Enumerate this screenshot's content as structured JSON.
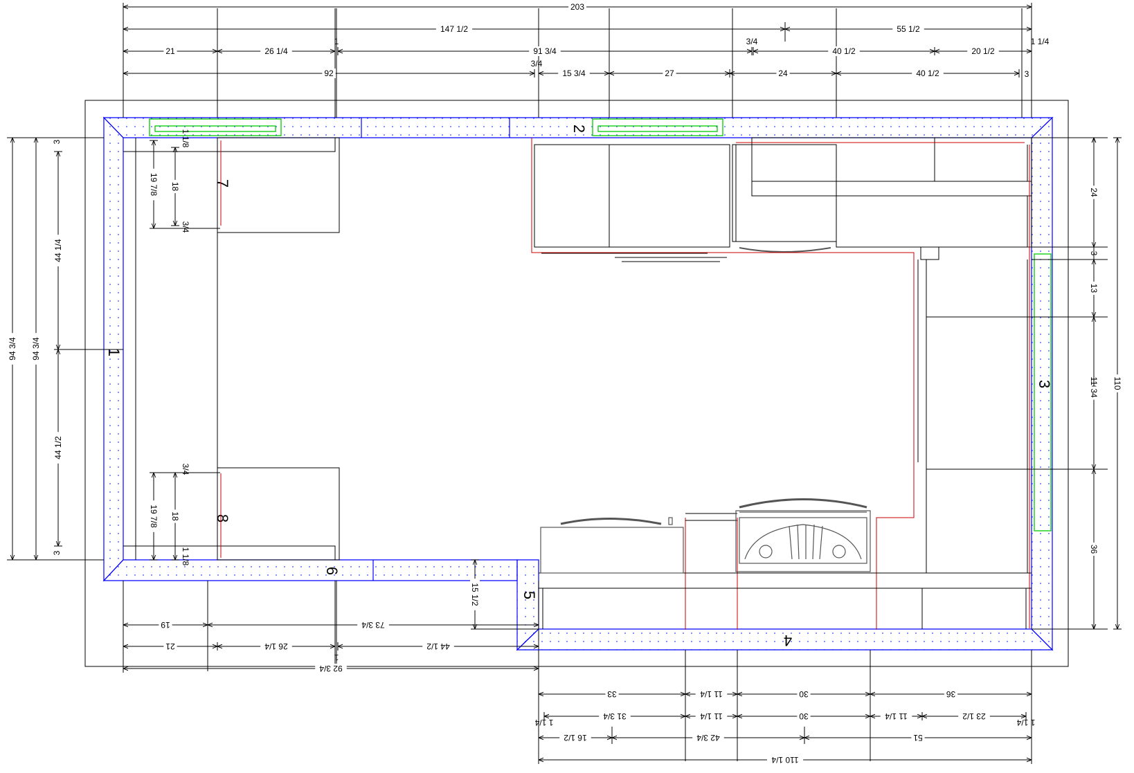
{
  "walls": {
    "w1": "1",
    "w2": "2",
    "w3": "3",
    "w4": "4",
    "w5": "5",
    "w6": "6",
    "w7": "7",
    "w8": "8"
  },
  "top": {
    "r1": [
      "203"
    ],
    "r2": [
      "147 1/2",
      "55 1/2"
    ],
    "r3": [
      "21",
      "26 1/4",
      "1",
      "91 3/4",
      "3/4",
      "40 1/2",
      "20 1/2",
      "1 1/4"
    ],
    "r4": [
      "92",
      "3/4",
      "15 3/4",
      "27",
      "24",
      "40 1/2",
      "3"
    ]
  },
  "left": {
    "outer": [
      "94 3/4",
      "94 3/4"
    ],
    "inner": [
      "3",
      "44 1/4",
      "44 1/2",
      "3"
    ],
    "upper": [
      "19 7/8",
      "18",
      "1 1/8",
      "3/4"
    ],
    "lower": [
      "19 7/8",
      "18",
      "3/4",
      "1 1/8"
    ]
  },
  "right": {
    "outer": [
      "110"
    ],
    "inner": [
      "24",
      "3",
      "13",
      "34",
      "36"
    ]
  },
  "bottom_left": {
    "r1": [
      "19",
      "73 3/4"
    ],
    "r2": [
      "21",
      "26 1/4",
      "44 1/2",
      "1"
    ],
    "r3": [
      "92 3/4"
    ],
    "wall5": [
      "15 1/2"
    ]
  },
  "bottom_right": {
    "r1": [
      "33",
      "11 1/4",
      "30",
      "36"
    ],
    "r2": [
      "1 1/4",
      "31 3/4",
      "11 1/4",
      "30",
      "11 1/4",
      "23 1/2",
      "1 1/4"
    ],
    "r3": [
      "16 1/2",
      "42 3/4",
      "51"
    ],
    "r4": [
      "110 1/4"
    ]
  },
  "colors": {
    "wall_outline": "#0000ff",
    "cabinet_outline": "#cc0000",
    "window": "#00cc00",
    "dimension": "#000000",
    "appliance": "#555555"
  }
}
